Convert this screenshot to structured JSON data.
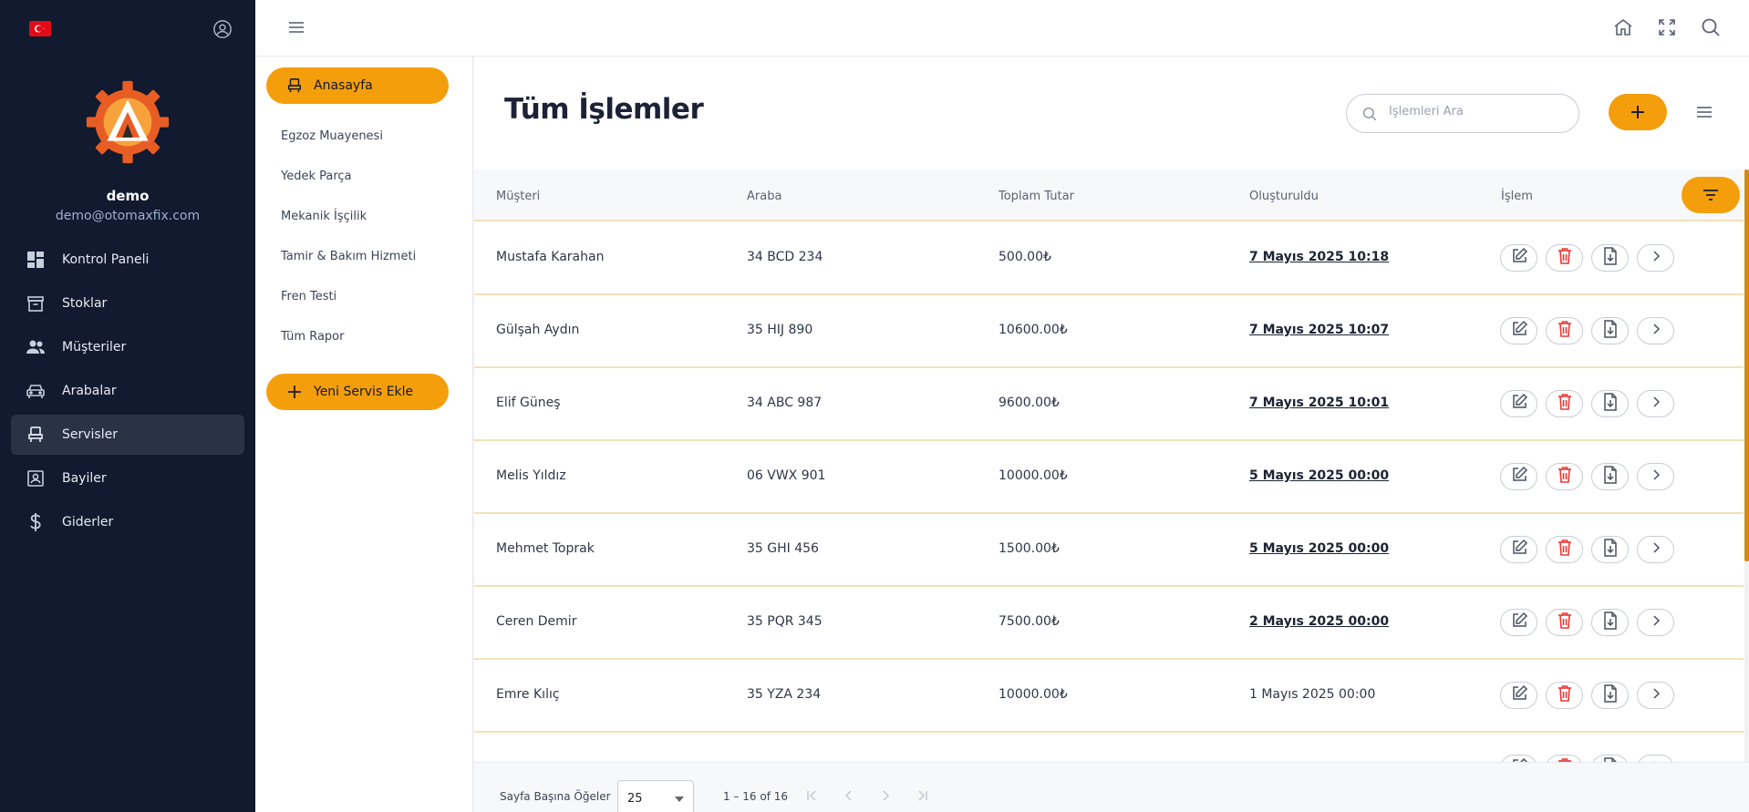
{
  "sidebar": {
    "user": {
      "name": "demo",
      "email": "demo@otomaxfix.com"
    },
    "items": [
      {
        "label": "Kontrol Paneli",
        "icon": "dashboard-icon",
        "active": false
      },
      {
        "label": "Stoklar",
        "icon": "archive-icon",
        "active": false
      },
      {
        "label": "Müşteriler",
        "icon": "people-icon",
        "active": false
      },
      {
        "label": "Arabalar",
        "icon": "car-icon",
        "active": false
      },
      {
        "label": "Servisler",
        "icon": "seat-icon",
        "active": true
      },
      {
        "label": "Bayiler",
        "icon": "contact-card-icon",
        "active": false
      },
      {
        "label": "Giderler",
        "icon": "dollar-icon",
        "active": false
      }
    ]
  },
  "subnav": {
    "home_label": "Anasayfa",
    "items": [
      "Egzoz Muayenesi",
      "Yedek Parça",
      "Mekanik İşçilik",
      "Tamir & Bakım Hizmeti",
      "Fren Testi",
      "Tüm Rapor"
    ],
    "new_service_label": "Yeni Servis Ekle"
  },
  "main": {
    "title": "Tüm İşlemler",
    "search": {
      "placeholder": "İşlemleri Ara",
      "value": ""
    }
  },
  "table": {
    "columns": [
      "Müşteri",
      "Araba",
      "Toplam Tutar",
      "Oluşturuldu",
      "İşlem"
    ],
    "rows": [
      {
        "customer": "Mustafa Karahan",
        "car": "34 BCD 234",
        "total": "500.00₺",
        "created": "7 Mayıs 2025 10:18"
      },
      {
        "customer": "Gülşah Aydın",
        "car": "35 HIJ 890",
        "total": "10600.00₺",
        "created": "7 Mayıs 2025 10:07"
      },
      {
        "customer": "Elif Güneş",
        "car": "34 ABC 987",
        "total": "9600.00₺",
        "created": "7 Mayıs 2025 10:01"
      },
      {
        "customer": "Melis Yıldız",
        "car": "06 VWX 901",
        "total": "10000.00₺",
        "created": "5 Mayıs 2025 00:00"
      },
      {
        "customer": "Mehmet Toprak",
        "car": "35 GHI 456",
        "total": "1500.00₺",
        "created": "5 Mayıs 2025 00:00"
      },
      {
        "customer": "Ceren Demir",
        "car": "35 PQR 345",
        "total": "7500.00₺",
        "created": "2 Mayıs 2025 00:00"
      },
      {
        "customer": "Emre Kılıç",
        "car": "35 YZA 234",
        "total": "10000.00₺",
        "created": "1 Mayıs 2025 00:00"
      }
    ]
  },
  "pagination": {
    "per_page_label": "Sayfa Başına Öğeler",
    "per_page_value": "25",
    "range": "1 – 16 of 16"
  },
  "colors": {
    "accent": "#f59e0b",
    "sidebar_bg": "#111a2e",
    "delete": "#e53935"
  }
}
